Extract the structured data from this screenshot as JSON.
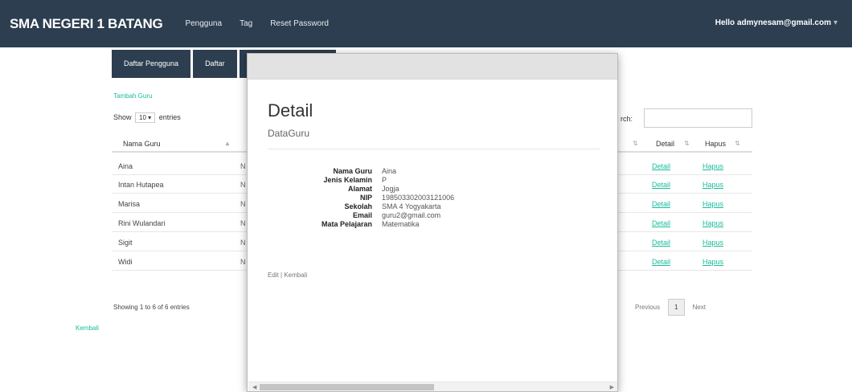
{
  "navbar": {
    "brand": "SMA NEGERI 1 BATANG",
    "links": [
      "Pengguna",
      "Tag",
      "Reset Password"
    ],
    "user": "Hello admynesam@gmail.com",
    "user_caret": "▾"
  },
  "tabs": [
    "Daftar Pengguna",
    "Daftar",
    ""
  ],
  "page": {
    "add_link": "Tambah Guru",
    "show_prefix": "Show",
    "show_value": "10",
    "show_suffix": "entries",
    "search_label": "rch:",
    "info": "Showing 1 to 6 of 6 entries",
    "prev": "Previous",
    "page_num": "1",
    "next": "Next",
    "back": "Kembali"
  },
  "table": {
    "headers": {
      "name": "Nama Guru",
      "detail": "Detail",
      "hapus": "Hapus"
    },
    "rows": [
      {
        "name": "Aina",
        "clip": "N",
        "detail": "Detail",
        "hapus": "Hapus"
      },
      {
        "name": "Intan Hutapea",
        "clip": "N",
        "detail": "Detail",
        "hapus": "Hapus"
      },
      {
        "name": "Marisa",
        "clip": "N",
        "detail": "Detail",
        "hapus": "Hapus"
      },
      {
        "name": "Rini Wulandari",
        "clip": "N",
        "detail": "Detail",
        "hapus": "Hapus"
      },
      {
        "name": "Sigit",
        "clip": "N",
        "detail": "Detail",
        "hapus": "Hapus"
      },
      {
        "name": "Widi",
        "clip": "N",
        "detail": "Detail",
        "hapus": "Hapus"
      }
    ]
  },
  "modal": {
    "title": "Detail",
    "subtitle": "DataGuru",
    "fields": [
      {
        "label": "Nama Guru",
        "value": "Aina"
      },
      {
        "label": "Jenis Kelamin",
        "value": "P"
      },
      {
        "label": "Alamat",
        "value": "Jogja"
      },
      {
        "label": "NIP",
        "value": "198503302003121006"
      },
      {
        "label": "Sekolah",
        "value": "SMA 4 Yogyakarta"
      },
      {
        "label": "Email",
        "value": "guru2@gmail.com"
      },
      {
        "label": "Mata Pelajaran",
        "value": "Matematika"
      }
    ],
    "edit": "Edit",
    "separator": "|",
    "back": "Kembali"
  },
  "colors": {
    "navbar": "#2c3e50",
    "link": "#18bc9c"
  }
}
